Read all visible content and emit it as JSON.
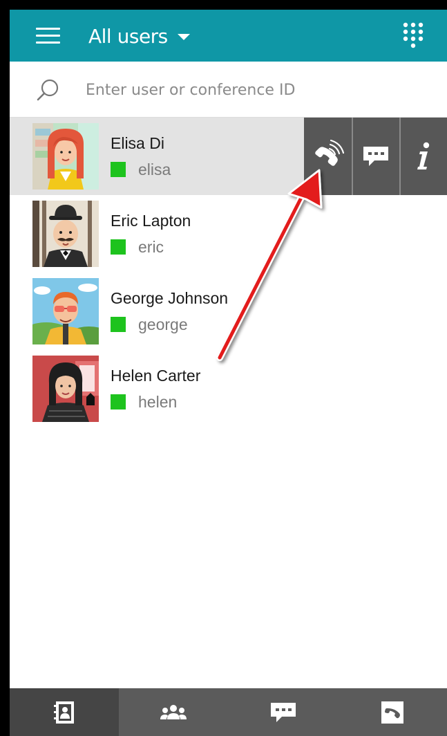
{
  "header": {
    "title": "All users",
    "menu_icon": "hamburger-icon",
    "dropdown_icon": "caret-down-icon",
    "keypad_icon": "dialpad-icon",
    "background_color": "#0f97a6"
  },
  "search": {
    "placeholder": "Enter user or conference ID",
    "value": "",
    "icon": "search-icon"
  },
  "users": [
    {
      "name": "Elisa Di",
      "handle": "elisa",
      "status": "online",
      "status_color": "#1ec31e",
      "selected": true
    },
    {
      "name": "Eric Lapton",
      "handle": "eric",
      "status": "online",
      "status_color": "#1ec31e",
      "selected": false
    },
    {
      "name": "George Johnson",
      "handle": "george",
      "status": "online",
      "status_color": "#1ec31e",
      "selected": false
    },
    {
      "name": "Helen Carter",
      "handle": "helen",
      "status": "online",
      "status_color": "#1ec31e",
      "selected": false
    }
  ],
  "row_actions": [
    {
      "icon": "call-icon"
    },
    {
      "icon": "chat-icon"
    },
    {
      "icon": "info-icon",
      "glyph": "i"
    }
  ],
  "bottom_tabs": [
    {
      "icon": "contacts-icon",
      "active": true
    },
    {
      "icon": "groups-icon",
      "active": false
    },
    {
      "icon": "chat-icon",
      "active": false
    },
    {
      "icon": "call-history-icon",
      "active": false
    }
  ],
  "annotation": {
    "type": "arrow",
    "color": "#e31b1b",
    "points_to": "call-icon"
  }
}
